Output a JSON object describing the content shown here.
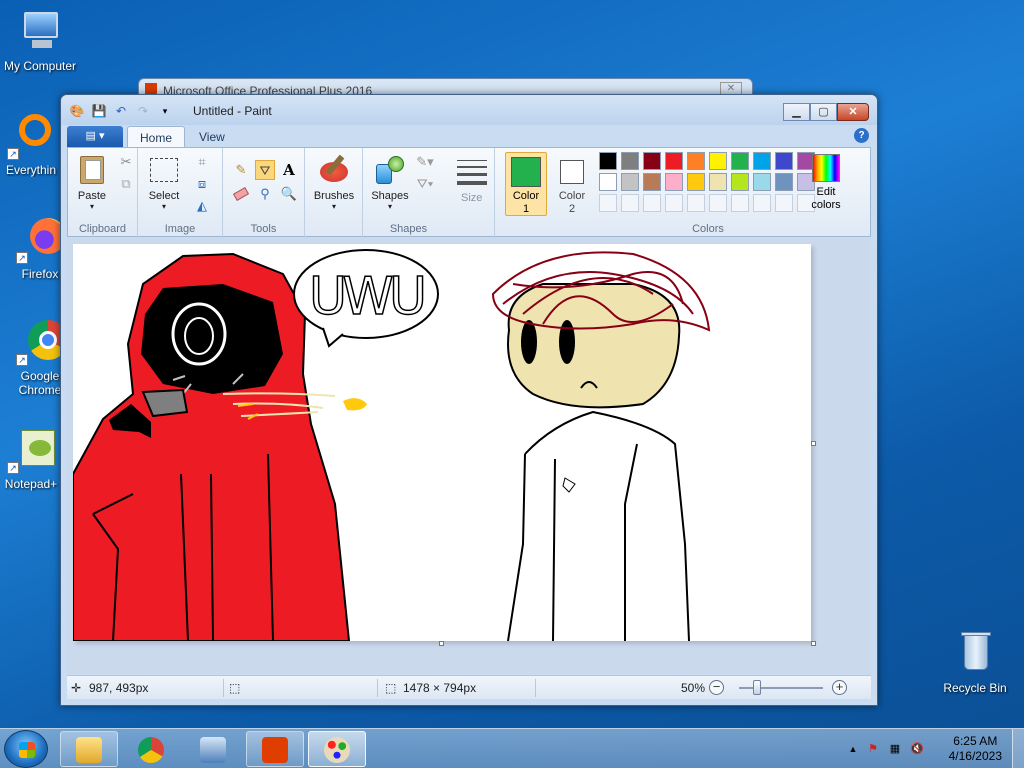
{
  "desktop": {
    "icons": [
      {
        "label": "My Computer"
      },
      {
        "label": "Everythin"
      },
      {
        "label": "Firefox"
      },
      {
        "label": "Google Chrome"
      },
      {
        "label": "Notepad+"
      },
      {
        "label": "Recycle Bin"
      }
    ]
  },
  "back_window": {
    "title": "Microsoft Office Professional Plus 2016",
    "close": "✕"
  },
  "paint": {
    "title": "Untitled - Paint",
    "tabs": {
      "file": "▤ ▾",
      "home": "Home",
      "view": "View",
      "help": "?"
    },
    "window_buttons": {
      "minimize": "▁",
      "maximize": "▢",
      "close": "✕"
    },
    "clipboard": {
      "paste": "Paste",
      "label": "Clipboard"
    },
    "image": {
      "select": "Select",
      "label": "Image"
    },
    "tools": {
      "label": "Tools",
      "text": "A"
    },
    "brushes": {
      "label": "Brushes"
    },
    "shapes": {
      "shapes": "Shapes",
      "label": "Shapes"
    },
    "size": {
      "label": "Size"
    },
    "colors": {
      "color1": "Color 1",
      "color2": "Color 2",
      "edit": "Edit colors",
      "label": "Colors",
      "color1_value": "#22b14c",
      "color2_value": "#ffffff",
      "palette_row1": [
        "#000000",
        "#7f7f7f",
        "#880015",
        "#ed1c24",
        "#ff7f27",
        "#fff200",
        "#22b14c",
        "#00a2e8",
        "#3f48cc",
        "#a349a4"
      ],
      "palette_row2": [
        "#ffffff",
        "#c3c3c3",
        "#b97a57",
        "#ffaec9",
        "#ffc90e",
        "#efe4b0",
        "#b5e61d",
        "#99d9ea",
        "#7092be",
        "#c8bfe7"
      ]
    },
    "canvas": {
      "bubble_text": "UWU"
    },
    "status": {
      "cursor": "987, 493px",
      "size": "1478 × 794px",
      "zoom": "50%",
      "zoom_out": "−",
      "zoom_in": "+",
      "zoom_level": 0.5
    }
  },
  "taskbar": {
    "time": "6:25 AM",
    "date": "4/16/2023"
  }
}
